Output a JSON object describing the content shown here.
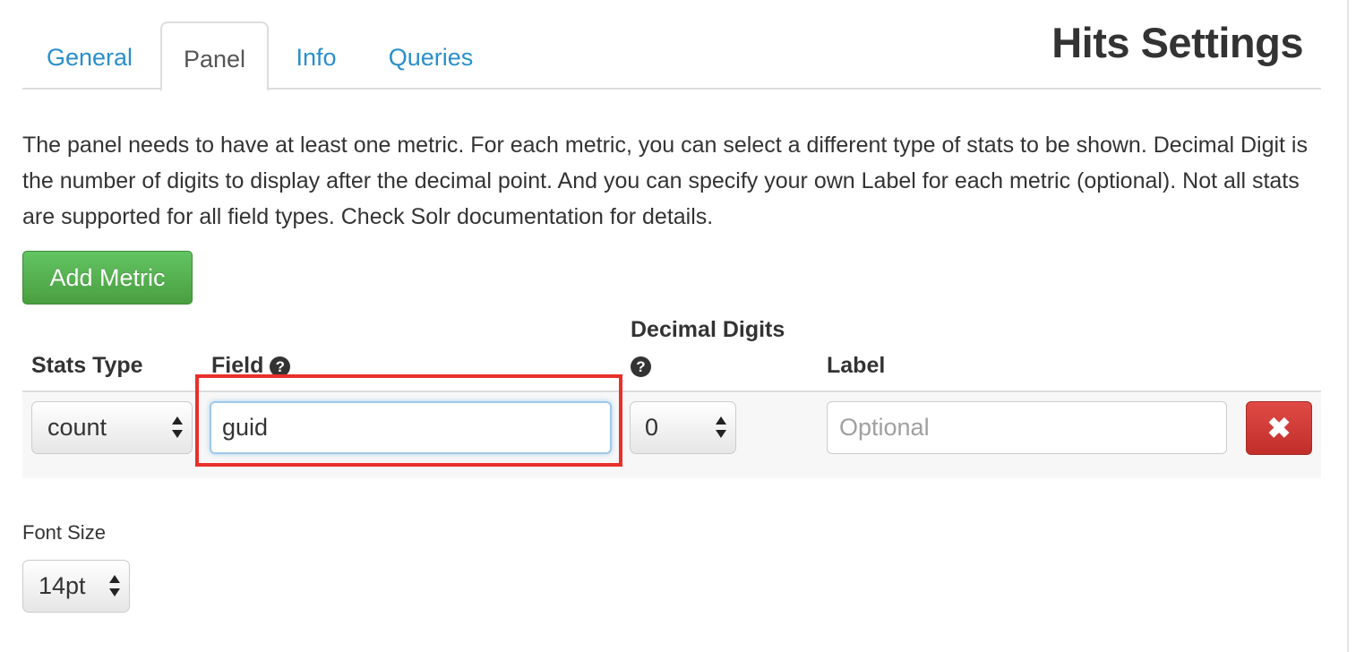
{
  "page": {
    "title": "Hits Settings"
  },
  "tabs": [
    {
      "label": "General",
      "active": false
    },
    {
      "label": "Panel",
      "active": true
    },
    {
      "label": "Info",
      "active": false
    },
    {
      "label": "Queries",
      "active": false
    }
  ],
  "description": "The panel needs to have at least one metric. For each metric, you can select a different type of stats to be shown. Decimal Digit is the number of digits to display after the decimal point. And you can specify your own Label for each metric (optional). Not all stats are supported for all field types. Check Solr documentation for details.",
  "add_metric_label": "Add Metric",
  "table": {
    "headers": {
      "stats_type": "Stats Type",
      "field": "Field",
      "decimal_digits": "Decimal Digits",
      "label": "Label"
    },
    "help_icon_glyph": "?",
    "rows": [
      {
        "stats_type": "count",
        "field": "guid",
        "decimal_digits": "0",
        "label_value": "",
        "label_placeholder": "Optional",
        "delete_glyph": "✖"
      }
    ]
  },
  "font_size": {
    "label": "Font Size",
    "value": "14pt"
  },
  "colors": {
    "tab_link": "#2a8fca",
    "add_button": "#5cb85c",
    "delete_button": "#d43f3a",
    "highlight": "#e8302a"
  },
  "icons": [
    "question-circle-icon",
    "close-icon",
    "select-arrows-icon"
  ]
}
